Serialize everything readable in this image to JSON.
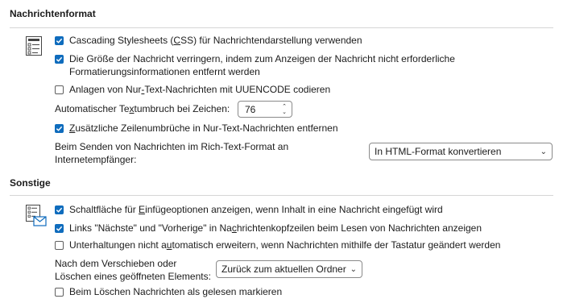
{
  "sections": {
    "message_format": {
      "title": "Nachrichtenformat",
      "css_checkbox": {
        "before": "Cascading Stylesheets (",
        "access": "C",
        "after": "SS) für Nachrichtendarstellung verwenden",
        "checked": true
      },
      "reduce_size": {
        "line1": "Die Größe der Nachricht verringern, indem zum Anzeigen der Nachricht nicht erforderliche",
        "line2": "Formatierungsinformationen entfernt werden",
        "checked": true
      },
      "uuencode": {
        "before": "Anlagen von Nur",
        "access": "-",
        "after": "Text-Nachrichten mit UUENCODE codieren",
        "checked": false
      },
      "wrap": {
        "before": "Automatischer Te",
        "access": "x",
        "after": "tumbruch bei Zeichen:",
        "value": "76"
      },
      "extra_breaks": {
        "access": "Z",
        "after": "usätzliche Zeilenumbrüche in Nur-Text-Nachrichten entfernen",
        "checked": true
      },
      "rtf": {
        "line1": "Beim Senden von Nachrichten im Rich-Text-Format an",
        "line2": "Internetempfänger:",
        "selected": "In HTML-Format konvertieren"
      }
    },
    "other": {
      "title": "Sonstige",
      "paste_options": {
        "before": "Schaltfläche für ",
        "access": "E",
        "after": "infügeoptionen anzeigen, wenn Inhalt in eine Nachricht eingefügt wird",
        "checked": true
      },
      "links": {
        "before": "Links \"Nächste\" und \"Vorherige\" in Na",
        "access": "c",
        "after": "hrichtenkopfzeilen beim Lesen von Nachrichten anzeigen",
        "checked": true
      },
      "expand": {
        "before": "Unterhaltungen nicht a",
        "access": "u",
        "after": "tomatisch erweitern, wenn Nachrichten mithilfe der Tastatur geändert werden",
        "checked": false
      },
      "after_move": {
        "line1": "Nach dem Verschieben oder",
        "line2": "Löschen eines geöffneten Elements:",
        "selected": "Zurück zum aktuellen Ordner"
      },
      "mark_read": {
        "label": "Beim Löschen Nachrichten als gelesen markieren",
        "checked": false
      }
    }
  }
}
